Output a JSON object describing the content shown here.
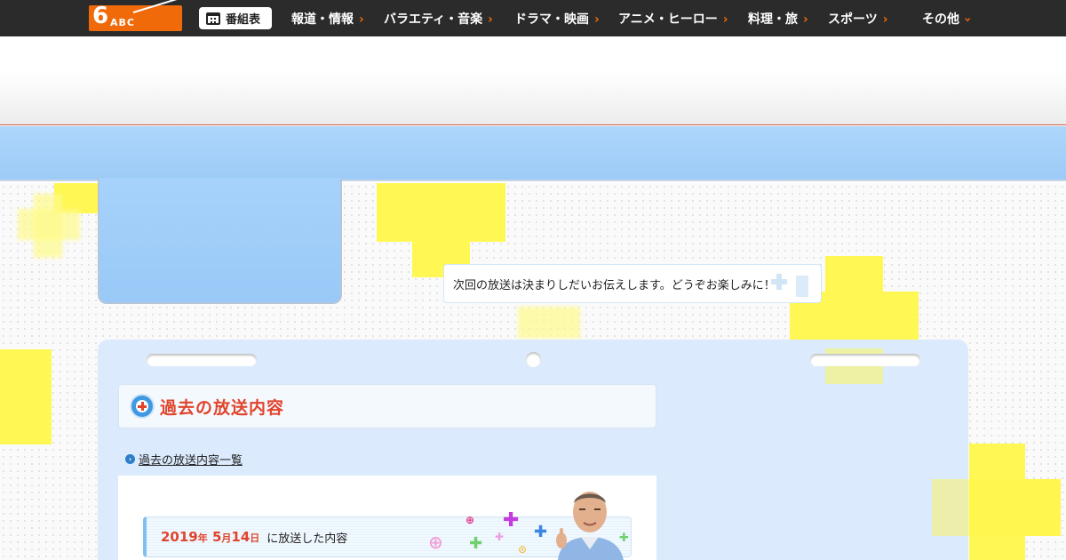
{
  "brand": {
    "logo_number": "6",
    "logo_letters": "ABC"
  },
  "nav": {
    "schedule_label": "番組表",
    "items": [
      "報道・情報",
      "バラエティ・音楽",
      "ドラマ・映画",
      "アニメ・ヒーロー",
      "料理・旅",
      "スポーツ"
    ],
    "more_label": "その他"
  },
  "next_broadcast": {
    "message": "次回の放送は決まりしだいお伝えします。どうぞお楽しみに！"
  },
  "past": {
    "section_title": "過去の放送内容",
    "list_link": "過去の放送内容一覧",
    "latest": {
      "year": "2019",
      "year_unit": "年",
      "month": "5",
      "month_unit": "月",
      "day": "14",
      "day_unit": "日",
      "suffix": "に放送した内容"
    }
  },
  "colors": {
    "accent": "#f06a0a",
    "title_red": "#e0442c",
    "sky": "#a6d2fb",
    "highlight_yellow": "#fff74a"
  }
}
